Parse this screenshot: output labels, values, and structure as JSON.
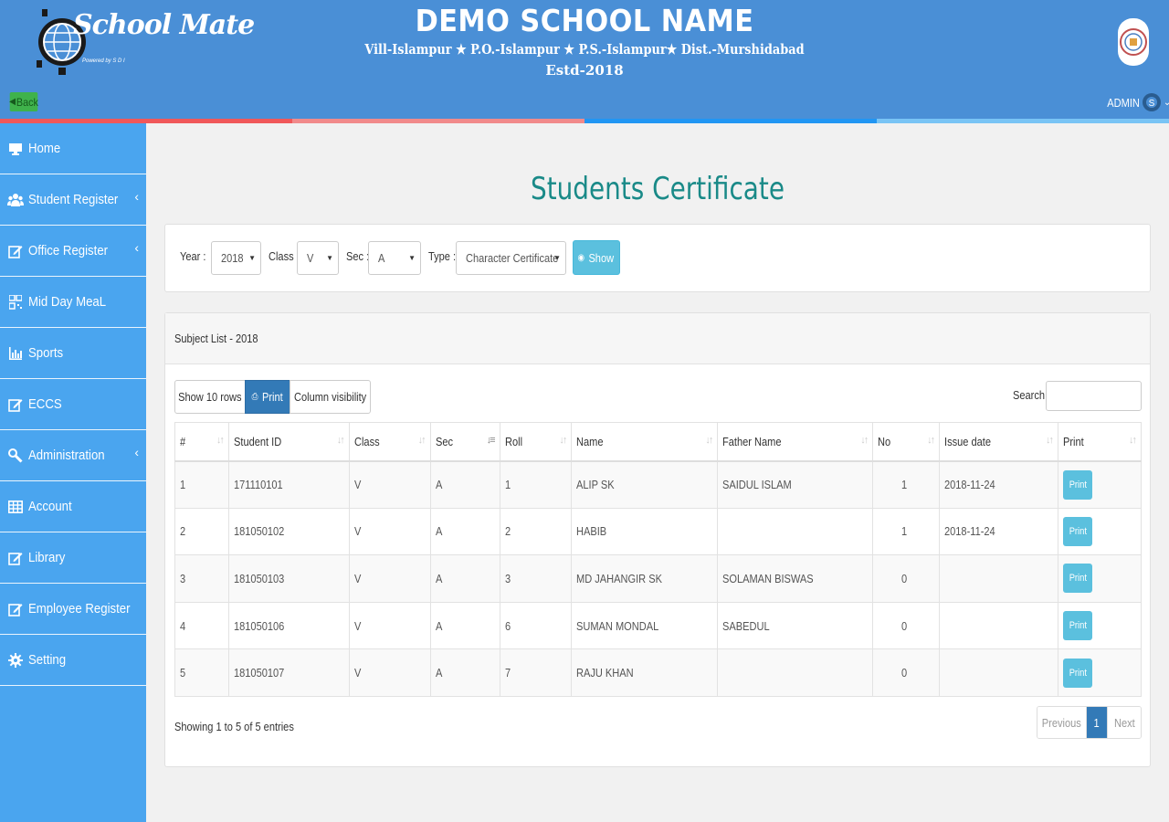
{
  "header": {
    "logo_text": "School Mate",
    "logo_sub": "Powered by S D I",
    "school_name": "DEMO SCHOOL NAME",
    "address": "Vill-Islampur ★ P.O.-Islampur ★ P.S.-Islampur★ Dist.-Murshidabad",
    "established": "Estd-2018",
    "back_label": "Back",
    "user_label": "ADMIN"
  },
  "sidebar": {
    "items": [
      {
        "label": "Home",
        "icon": "monitor-icon",
        "has_submenu": false
      },
      {
        "label": "Student Register",
        "icon": "users-icon",
        "has_submenu": true
      },
      {
        "label": "Office Register",
        "icon": "edit-icon",
        "has_submenu": true
      },
      {
        "label": "Mid Day MeaL",
        "icon": "qrcode-icon",
        "has_submenu": false
      },
      {
        "label": "Sports",
        "icon": "bar-chart-icon",
        "has_submenu": false
      },
      {
        "label": "ECCS",
        "icon": "edit-icon",
        "has_submenu": false
      },
      {
        "label": "Administration",
        "icon": "wrench-icon",
        "has_submenu": true
      },
      {
        "label": "Account",
        "icon": "table-icon",
        "has_submenu": false
      },
      {
        "label": "Library",
        "icon": "edit-icon",
        "has_submenu": false
      },
      {
        "label": "Employee Register",
        "icon": "edit-icon",
        "has_submenu": false
      },
      {
        "label": "Setting",
        "icon": "cog-icon",
        "has_submenu": false
      }
    ]
  },
  "main": {
    "title": "Students Certificate",
    "filters": {
      "year_label": "Year :",
      "year_value": "2018",
      "class_label": "Class :",
      "class_value": "V",
      "sec_label": "Sec :",
      "sec_value": "A",
      "type_label": "Type :",
      "type_value": "Character Certificate",
      "show_label": "Show"
    },
    "list": {
      "title": "Subject List - 2018",
      "btn_show_rows": "Show 10 rows",
      "btn_print": "Print",
      "btn_column_visibility": "Column visibility",
      "search_label": "Search:",
      "search_value": "",
      "columns": [
        "#",
        "Student ID",
        "Class",
        "Sec",
        "Roll",
        "Name",
        "Father Name",
        "No",
        "Issue date",
        "Print"
      ],
      "rows": [
        {
          "n": "1",
          "student_id": "171110101",
          "class": "V",
          "sec": "A",
          "roll": "1",
          "name": "ALIP SK",
          "father": "SAIDUL ISLAM",
          "no": "1",
          "issue_date": "2018-11-24",
          "print": "Print"
        },
        {
          "n": "2",
          "student_id": "181050102",
          "class": "V",
          "sec": "A",
          "roll": "2",
          "name": "HABIB",
          "father": "",
          "no": "1",
          "issue_date": "2018-11-24",
          "print": "Print"
        },
        {
          "n": "3",
          "student_id": "181050103",
          "class": "V",
          "sec": "A",
          "roll": "3",
          "name": "MD JAHANGIR SK",
          "father": "SOLAMAN BISWAS",
          "no": "0",
          "issue_date": "",
          "print": "Print"
        },
        {
          "n": "4",
          "student_id": "181050106",
          "class": "V",
          "sec": "A",
          "roll": "6",
          "name": "SUMAN MONDAL",
          "father": "SABEDUL",
          "no": "0",
          "issue_date": "",
          "print": "Print"
        },
        {
          "n": "5",
          "student_id": "181050107",
          "class": "V",
          "sec": "A",
          "roll": "7",
          "name": "RAJU KHAN",
          "father": "",
          "no": "0",
          "issue_date": "",
          "print": "Print"
        }
      ],
      "info": "Showing 1 to 5 of 5 entries",
      "pagination": {
        "previous": "Previous",
        "current": "1",
        "next": "Next"
      }
    }
  },
  "colors": {
    "header_bg": "#4a8fd6",
    "sidebar_bg": "#4aa5ef",
    "title_teal": "#1a8a88",
    "info_btn": "#5bc0de",
    "primary": "#337ab7",
    "back_green": "#3fb24b",
    "stripe_colors": [
      "#f0585a",
      "#f18a8b",
      "#2196f3",
      "#79c4f5"
    ]
  }
}
